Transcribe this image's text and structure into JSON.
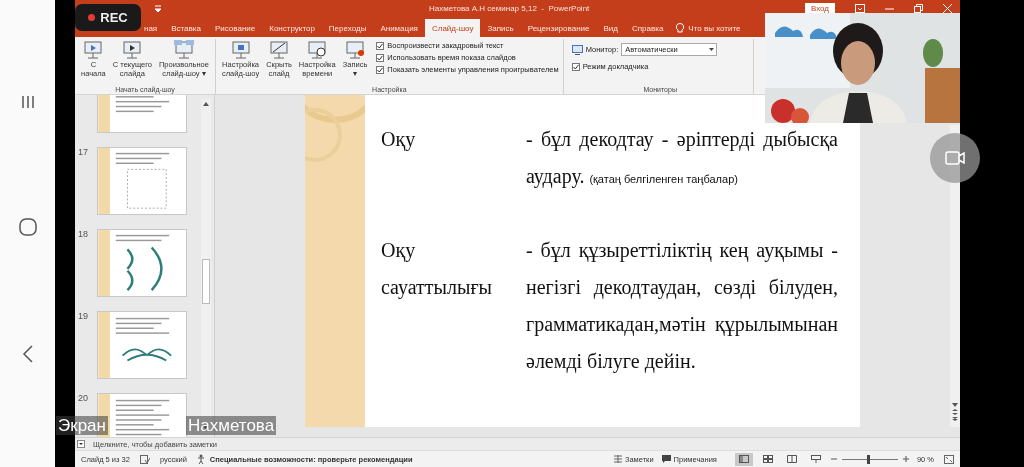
{
  "recording": {
    "label": "REC"
  },
  "window": {
    "title": "Нахметова А.Н семинар 5,12  -  PowerPoint",
    "sign_in": "Вход"
  },
  "tabs": [
    {
      "label": "ная",
      "selected": false
    },
    {
      "label": "Вставка",
      "selected": false
    },
    {
      "label": "Рисование",
      "selected": false
    },
    {
      "label": "Конструктор",
      "selected": false
    },
    {
      "label": "Переходы",
      "selected": false
    },
    {
      "label": "Анимация",
      "selected": false
    },
    {
      "label": "Слайд-шоу",
      "selected": true
    },
    {
      "label": "Запись",
      "selected": false
    },
    {
      "label": "Рецензирование",
      "selected": false
    },
    {
      "label": "Вид",
      "selected": false
    },
    {
      "label": "Справка",
      "selected": false
    }
  ],
  "tell_me": "Что вы хотите",
  "ribbon": {
    "start_group": {
      "label": "Начать слайд-шоу",
      "buttons": [
        {
          "kind": "from-start",
          "lines": [
            "С",
            "начала"
          ]
        },
        {
          "kind": "from-current",
          "lines": [
            "С текущего",
            "слайда"
          ]
        },
        {
          "kind": "custom",
          "lines": [
            "Произвольное",
            "слайд-шоу ▾"
          ]
        }
      ]
    },
    "setup_group": {
      "label": "Настройка",
      "buttons": [
        {
          "kind": "setup",
          "lines": [
            "Настройка",
            "слайд-шоу"
          ]
        },
        {
          "kind": "hide",
          "lines": [
            "Скрыть",
            "слайд"
          ]
        },
        {
          "kind": "timing",
          "lines": [
            "Настройка",
            "времени"
          ]
        },
        {
          "kind": "record",
          "lines": [
            "Запись",
            "▾"
          ]
        }
      ],
      "checkboxes": [
        {
          "label": "Воспроизвести закадровый текст",
          "checked": true
        },
        {
          "label": "Использовать время показа слайдов",
          "checked": true
        },
        {
          "label": "Показать элементы управления проигрывателем",
          "checked": true
        }
      ]
    },
    "monitors_group": {
      "label": "Мониторы",
      "monitor_label": "Монитор:",
      "monitor_value": "Автоматически",
      "presenter_view": {
        "label": "Режим докладчика",
        "checked": true
      }
    }
  },
  "thumbnails": [
    {
      "kind": "list"
    },
    {
      "number": "17",
      "kind": "grid"
    },
    {
      "number": "18",
      "kind": "arcs"
    },
    {
      "number": "19",
      "kind": "bridges"
    },
    {
      "number": "20",
      "kind": "list"
    }
  ],
  "slide": {
    "rows": [
      {
        "term": "Оқу",
        "definition": "- бұл декодтау - әріптерді дыбысқа аудару.",
        "note": "(қатаң белгіленген таңбалар)"
      },
      {
        "term": "Оқу сауаттылығы",
        "definition": "- бұл құзыреттіліктің кең ауқымы - негізгі декодтаудан, сөзді білуден, грамматикадан,мәтін құрылымынан әлемді білуге дейін."
      }
    ]
  },
  "notes_placeholder": "Щелкните, чтобы добавить заметки",
  "caption": [
    "Экран",
    "Нахметова"
  ],
  "webcam": {
    "kind": "picture"
  },
  "status_bar": {
    "slide": "Слайд 5 из 32",
    "language": "русский",
    "accessibility": "Специальные возможности: проверьте рекомендации",
    "notes": "Заметки",
    "comments": "Примечания",
    "views": [
      {
        "kind": "normal",
        "selected": true
      },
      {
        "kind": "sorter",
        "selected": false
      },
      {
        "kind": "reading",
        "selected": false
      },
      {
        "kind": "show",
        "selected": false
      }
    ],
    "zoom": {
      "level": 0.45,
      "reading": "90 %"
    }
  }
}
